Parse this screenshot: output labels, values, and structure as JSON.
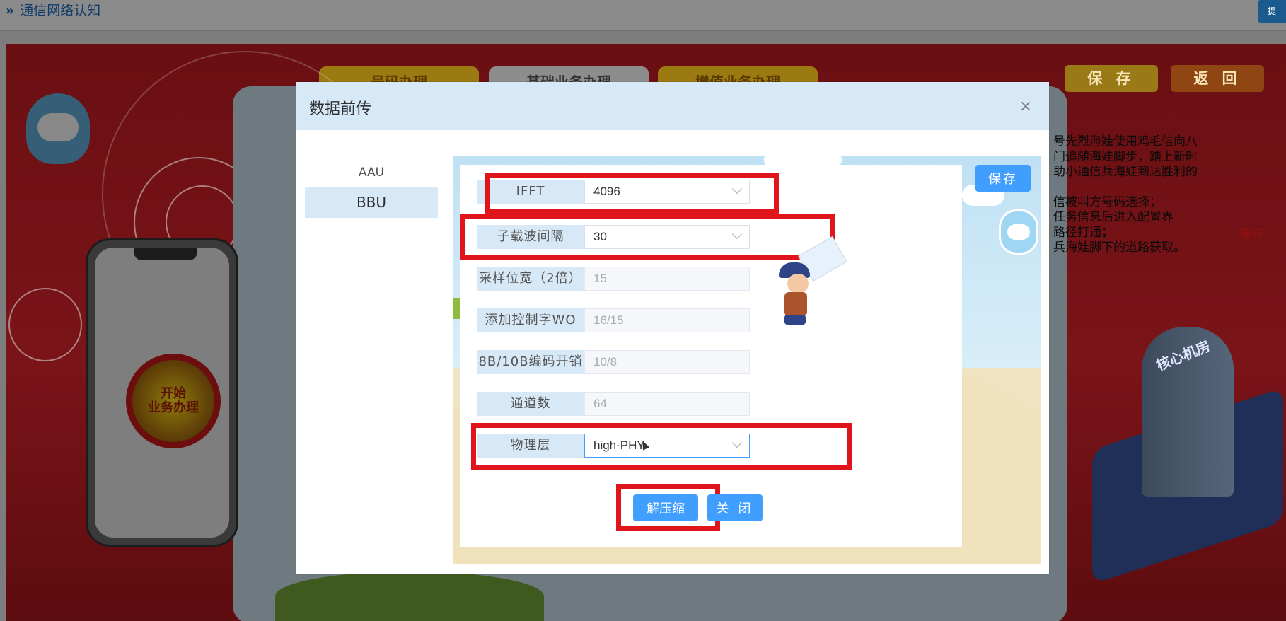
{
  "topbar": {
    "breadcrumb": "通信网络认知",
    "corner_button": "提"
  },
  "scene": {
    "tabs": [
      "号码办理",
      "基础业务办理",
      "增值业务办理"
    ],
    "save_label": "保 存",
    "back_label": "返 回",
    "start_button": [
      "开始",
      "业务办理"
    ],
    "story_lines": [
      "号先烈海娃使用鸡毛信向八",
      "门追随海娃脚步，踏上新时",
      "助小通信兵海娃到达胜利的",
      "",
      "信被叫方号码选择；",
      "任务信息后进入配置界",
      "路径打通；",
      "兵海娃脚下的道路获取。"
    ],
    "building_label": "核心机房",
    "building_sign": "能行"
  },
  "modal": {
    "title": "数据前传",
    "close_glyph": "×",
    "sidebar": [
      {
        "label": "AAU",
        "active": false
      },
      {
        "label": "BBU",
        "active": true
      }
    ],
    "save_label": "保存",
    "form": [
      {
        "label": "IFFT",
        "value": "4096",
        "type": "select",
        "highlighted": true
      },
      {
        "label": "子载波间隔",
        "value": "30",
        "type": "select",
        "highlighted": true
      },
      {
        "label": "采样位宽（2倍）",
        "value": "15",
        "type": "disabled",
        "highlighted": false
      },
      {
        "label": "添加控制字WO",
        "value": "16/15",
        "type": "disabled",
        "highlighted": false
      },
      {
        "label": "8B/10B编码开销",
        "value": "10/8",
        "type": "disabled",
        "highlighted": false
      },
      {
        "label": "通道数",
        "value": "64",
        "type": "disabled",
        "highlighted": false
      },
      {
        "label": "物理层",
        "value": "high-PHY",
        "type": "select",
        "highlighted": true
      }
    ],
    "decompress_label": "解压缩",
    "close_label": "关 闭",
    "colors": {
      "primary": "#409eff",
      "header": "#d7e8f6",
      "highlight": "#e0141b"
    }
  }
}
